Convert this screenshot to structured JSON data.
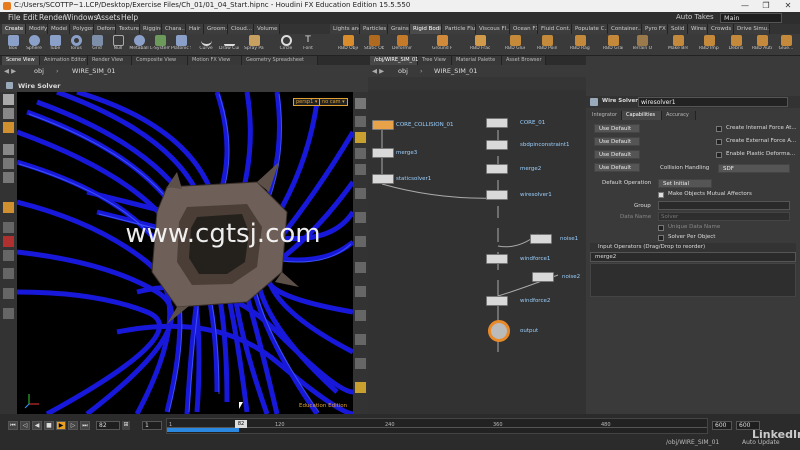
{
  "window": {
    "title": "C:/Users/SCOTTP~1.LCP/Desktop/Exercise Files/Ch_01/01_04_Start.hipnc - Houdini FX Education Edition 15.5.550",
    "minimize": "—",
    "maximize": "❐",
    "close": "✕"
  },
  "menu": {
    "items": [
      "File",
      "Edit",
      "Render",
      "Windows",
      "Assets",
      "Help"
    ],
    "auto_takes": "Auto Takes",
    "desktop": "Main"
  },
  "shelf": {
    "left_tabs": [
      "Create",
      "Modify",
      "Model",
      "Polygon",
      "Deform",
      "Texture",
      "Rigging",
      "Chara...",
      "Hair",
      "Groom...",
      "Cloud...",
      "Volume"
    ],
    "right_tabs": [
      "Lights and...",
      "Particles",
      "Grains",
      "Rigid Bodies",
      "Particle Flu...",
      "Viscous Fl...",
      "Ocean FX",
      "Fluid Cont...",
      "Populate C...",
      "Container...",
      "Pyro FX",
      "Solid",
      "Wires",
      "Crowds",
      "Drive Simu..."
    ],
    "left_tools": [
      "Box",
      "Sphere",
      "Tube",
      "Torus",
      "Grid",
      "Null",
      "Metaball",
      "L-System",
      "Platonic Sol...",
      "Curve",
      "Draw Curve",
      "Spray Paint",
      "Circle",
      "Font"
    ],
    "right_tools": [
      "RBD Object",
      "Static Object",
      "Deforming...",
      "Ground Plane",
      "RBD Fractur...",
      "RBD Glue O...",
      "RBD Point...",
      "RBD Ragdol...",
      "RBD Grains",
      "Terrain Object",
      "Make Break...",
      "RBD Impacts",
      "Debris",
      "RBD Auto F...",
      "Glue..."
    ]
  },
  "viewer": {
    "tabs": [
      "Scene View",
      "Animation Editor",
      "Render View",
      "Composite View",
      "Motion FX View",
      "Geometry Spreadsheet"
    ],
    "path_root": "obj",
    "path_node": "WIRE_SIM_01",
    "title": "Wire Solver",
    "camera": "persp1 ▾",
    "cam_menu": "no cam ▾",
    "edition": "Education Edition",
    "watermark": "www.cgtsj.com"
  },
  "network": {
    "tabs": [
      "/obj/WIRE_SIM_01",
      "Tree View",
      "Material Palette",
      "Asset Browser"
    ],
    "path_root": "obj",
    "path_node": "WIRE_SIM_01",
    "nodes": [
      {
        "label": "CORE_COLLISION_01",
        "color": "#e8a24a"
      },
      {
        "label": "CORE_01",
        "color": "#d9d9d9"
      },
      {
        "label": "merge3",
        "color": "#d9d9d9"
      },
      {
        "label": "sbdpinconstraint1",
        "color": "#d9d9d9"
      },
      {
        "label": "staticsolver1",
        "color": "#d9d9d9"
      },
      {
        "label": "merge2",
        "color": "#d9d9d9"
      },
      {
        "label": "wiresolver1",
        "color": "#d9d9d9"
      },
      {
        "label": "noise1",
        "color": "#d9d9d9"
      },
      {
        "label": "windforce1",
        "color": "#d9d9d9"
      },
      {
        "label": "noise2",
        "color": "#d9d9d9"
      },
      {
        "label": "windforce2",
        "color": "#d9d9d9"
      },
      {
        "label": "output",
        "color": "#e88a2a"
      }
    ]
  },
  "params": {
    "node_type": "Wire Solver",
    "node_name": "wiresolver1",
    "tabs": [
      "Integrator",
      "Capabilities",
      "Accuracy"
    ],
    "use_default": "Use Default",
    "create_internal": "Create Internal Force At...",
    "create_external": "Create External Force A...",
    "enable_plastic": "Enable Plastic Deforma...",
    "collision_handling_label": "Collision Handling",
    "collision_handling_value": "SDF",
    "default_operation_label": "Default Operation",
    "default_operation_value": "Set Initial",
    "make_objects_mutual": "Make Objects Mutual Affectors",
    "group_label": "Group",
    "data_name_label": "Data Name",
    "data_name_value": "Solver",
    "unique_data_name": "Unique Data Name",
    "solver_per_object": "Solver Per Object",
    "input_operators": "Input Operators (Drag/Drop to reorder)",
    "input_item": "merge2"
  },
  "timeline": {
    "current_frame": "82",
    "step": "1",
    "start": "1",
    "ticks": [
      "120",
      "240",
      "360",
      "480"
    ],
    "playhead_label": "82",
    "end_frame": "600",
    "end_frame2": "600"
  },
  "status": {
    "path": "/obj/WIRE_SIM_01",
    "auto_update": "Auto Update",
    "linkedin": "LinkedIn"
  }
}
